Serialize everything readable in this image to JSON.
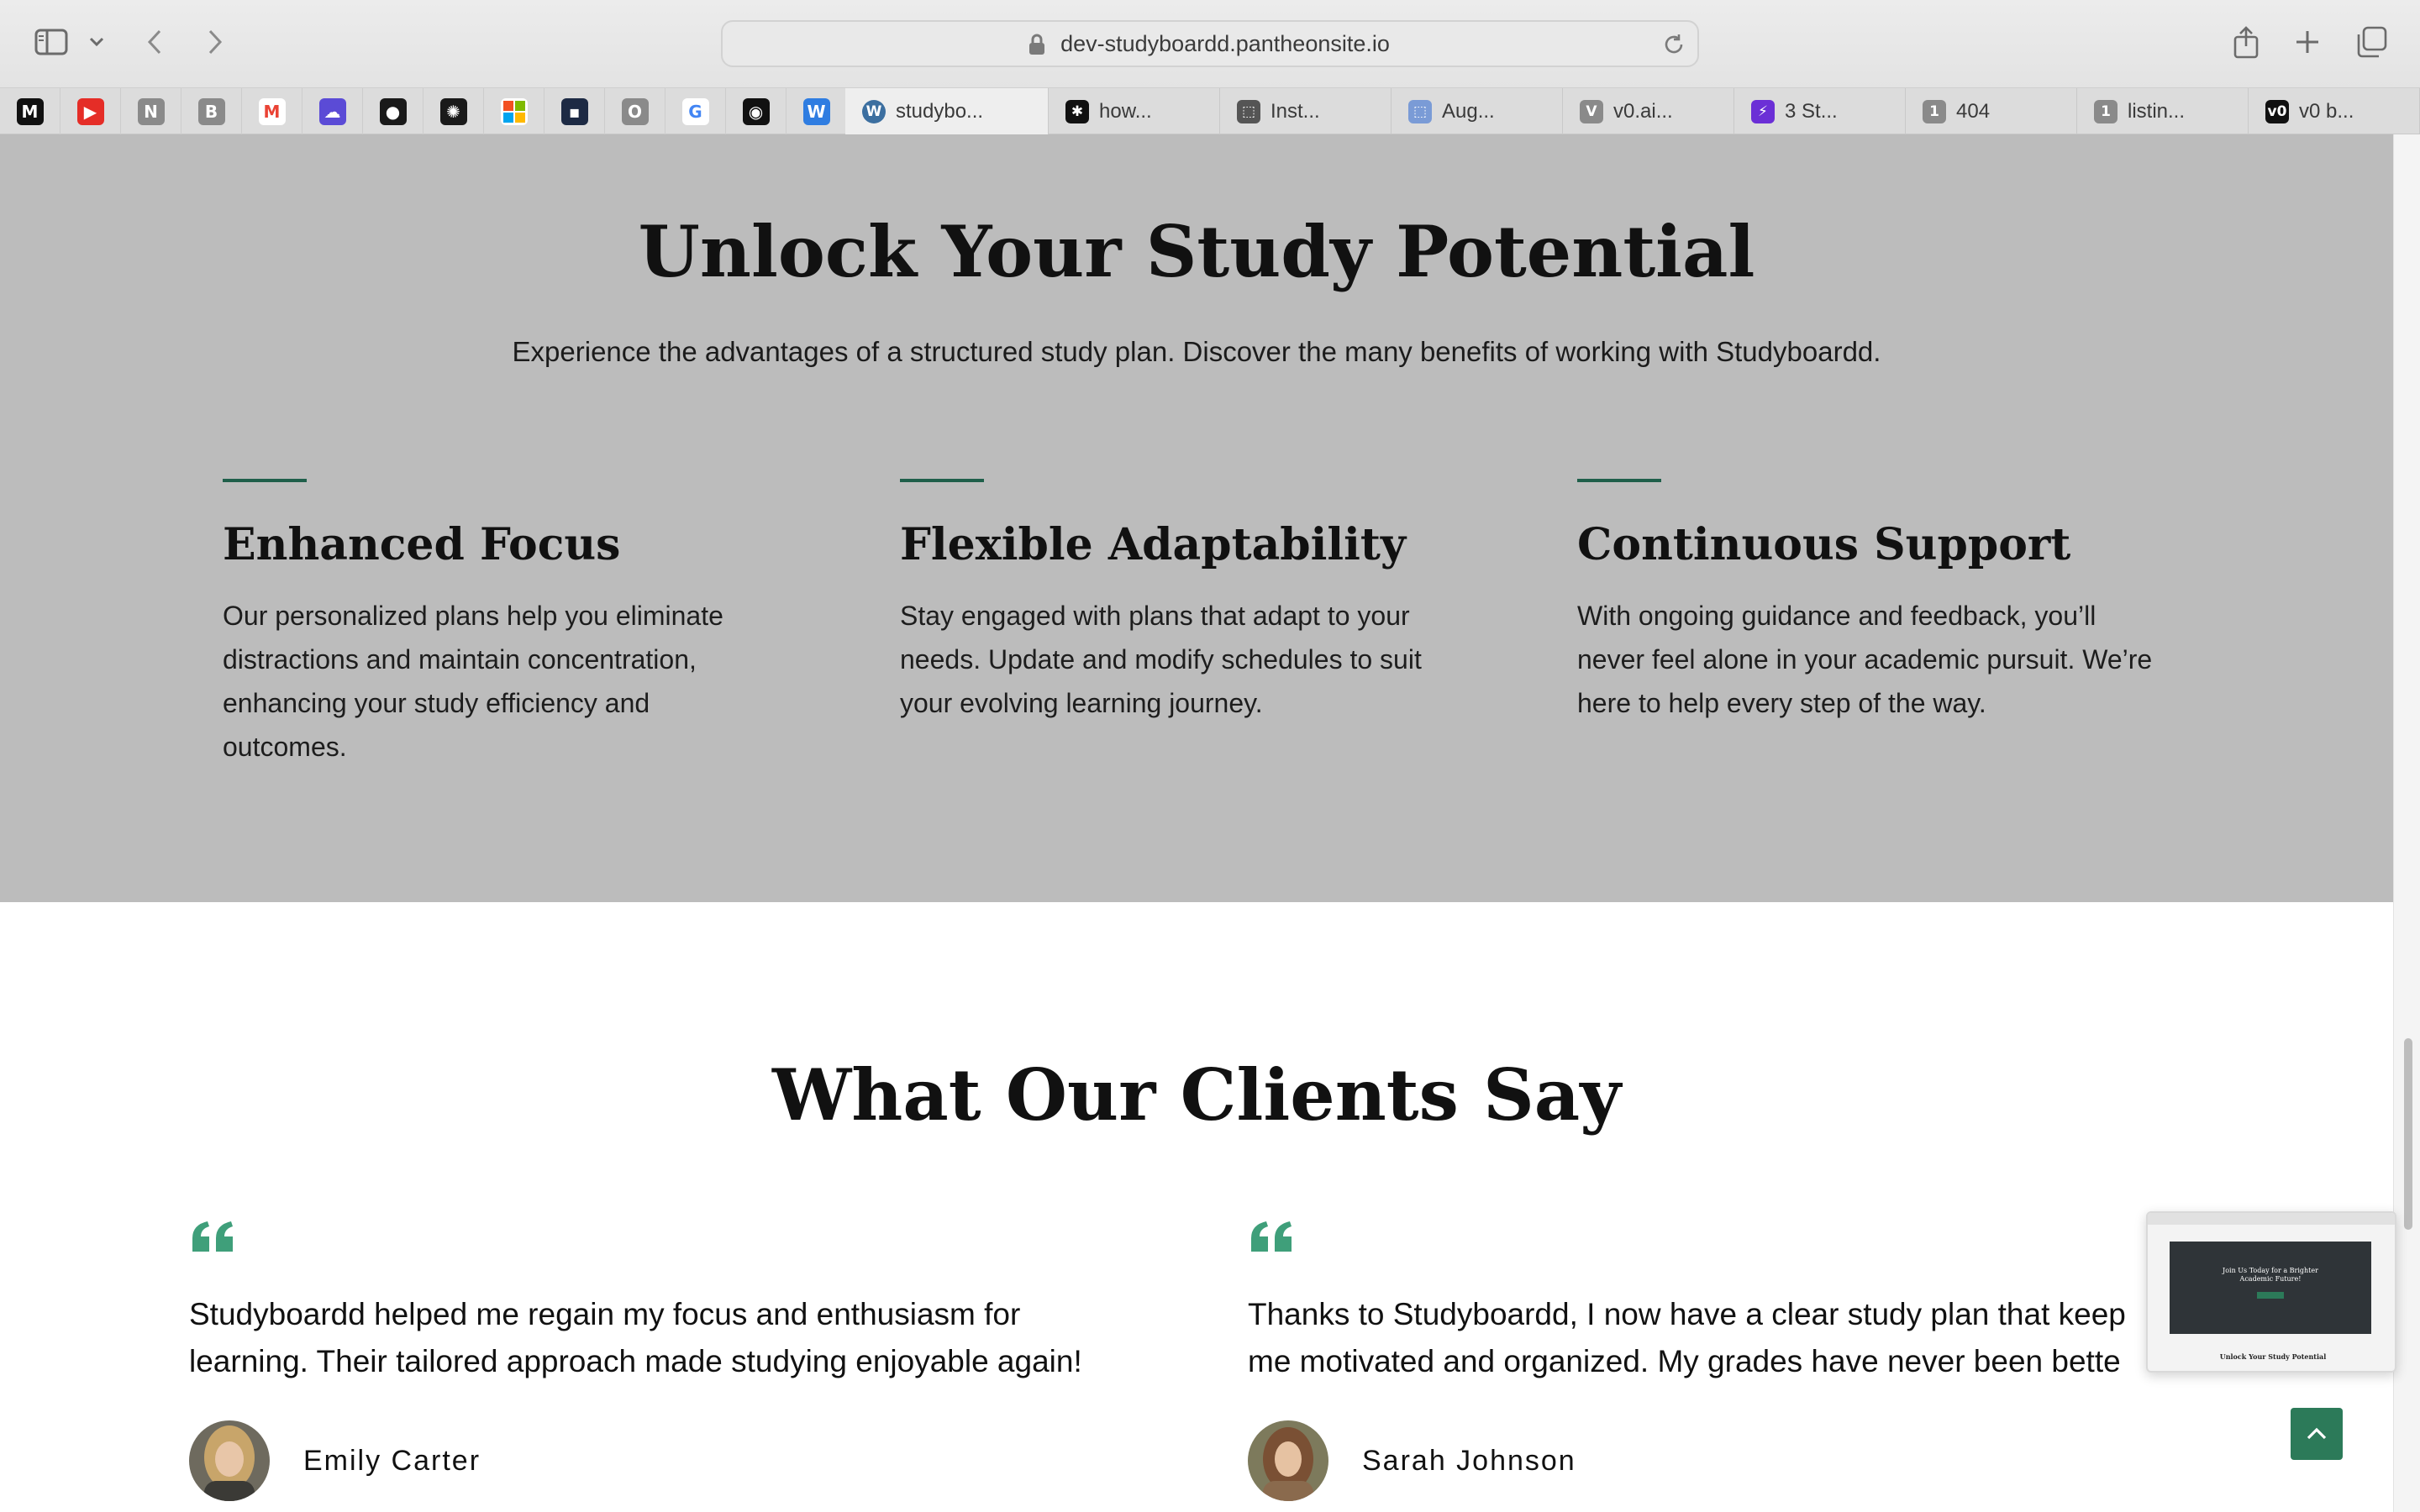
{
  "browser": {
    "url": "dev-studyboardd.pantheonsite.io",
    "pinned_tabs": [
      {
        "icon": "medium-icon",
        "color": "#111111",
        "glyph": "M"
      },
      {
        "icon": "youtube-icon",
        "color": "#e52d27",
        "glyph": "▶"
      },
      {
        "icon": "n-icon",
        "color": "#8a8a8a",
        "glyph": "N"
      },
      {
        "icon": "b-icon",
        "color": "#8a8a8a",
        "glyph": "B"
      },
      {
        "icon": "gmail-icon",
        "color": "#ffffff",
        "glyph": "M"
      },
      {
        "icon": "cloud-icon",
        "color": "#5b4bd6",
        "glyph": "☁"
      },
      {
        "icon": "github-icon",
        "color": "#1a1a1a",
        "glyph": "●"
      },
      {
        "icon": "openai-icon",
        "color": "#1a1a1a",
        "glyph": "✺"
      },
      {
        "icon": "microsoft-icon",
        "color": "#ffffff",
        "glyph": ""
      },
      {
        "icon": "dark-square-icon",
        "color": "#1d2a44",
        "glyph": "▪"
      },
      {
        "icon": "o-icon",
        "color": "#8a8a8a",
        "glyph": "O"
      },
      {
        "icon": "google-icon",
        "color": "#ffffff",
        "glyph": "G"
      },
      {
        "icon": "camera-icon",
        "color": "#111111",
        "glyph": "◉"
      },
      {
        "icon": "w-icon",
        "color": "#2f7de1",
        "glyph": "W"
      }
    ],
    "tabs": [
      {
        "label": "studybo...",
        "icon": "wordpress-icon",
        "color": "#3c6fa0",
        "glyph": "W",
        "active": true
      },
      {
        "label": "how...",
        "icon": "perplexity-icon",
        "color": "#111111",
        "glyph": "✱",
        "active": false
      },
      {
        "label": "Inst...",
        "icon": "scan-icon",
        "color": "#555555",
        "glyph": "⬚",
        "active": false
      },
      {
        "label": "Aug...",
        "icon": "bot-icon",
        "color": "#7a9bd6",
        "glyph": "⬚",
        "active": false
      },
      {
        "label": "v0.ai...",
        "icon": "v-icon",
        "color": "#8a8a8a",
        "glyph": "V",
        "active": false
      },
      {
        "label": "3 St...",
        "icon": "lightning-icon",
        "color": "#6b2fd6",
        "glyph": "⚡",
        "active": false
      },
      {
        "label": "404",
        "icon": "one-icon",
        "color": "#8a8a8a",
        "glyph": "1",
        "active": false
      },
      {
        "label": "listin...",
        "icon": "one-icon",
        "color": "#8a8a8a",
        "glyph": "1",
        "active": false
      },
      {
        "label": "v0 b...",
        "icon": "v0-icon",
        "color": "#111111",
        "glyph": "v0",
        "active": false
      }
    ]
  },
  "benefits": {
    "title": "Unlock Your Study Potential",
    "subtitle": "Experience the advantages of a structured study plan. Discover the many benefits of working with Studyboardd.",
    "features": [
      {
        "title": "Enhanced Focus",
        "text": "Our personalized plans help you eliminate distractions and maintain concentration, enhancing your study efficiency and outcomes."
      },
      {
        "title": "Flexible Adaptability",
        "text": "Stay engaged with plans that adapt to your needs. Update and modify schedules to suit your evolving learning journey."
      },
      {
        "title": "Continuous Support",
        "text": "With ongoing guidance and feedback, you’ll never feel alone in your academic pursuit. We’re here to help every step of the way."
      }
    ],
    "accent_color": "#1f5f4a",
    "background": "#bcbcbc"
  },
  "testimonials": {
    "title": "What Our Clients Say",
    "quote_color": "#3f9f7a",
    "items": [
      {
        "line1": "Studyboardd helped me regain my focus and enthusiasm for",
        "line2": "learning. Their tailored approach made studying enjoyable again!",
        "name": "Emily Carter"
      },
      {
        "line1": "Thanks to Studyboardd, I now have a clear study plan that keep",
        "line2": "me motivated and organized. My grades have never been bette",
        "name": "Sarah Johnson"
      }
    ]
  },
  "preview": {
    "hero_line": "Join Us Today for a Brighter Academic Future!",
    "section_title": "Unlock Your Study Potential"
  },
  "back_to_top": {
    "icon": "chevron-up-icon",
    "color": "#2c7a59"
  }
}
